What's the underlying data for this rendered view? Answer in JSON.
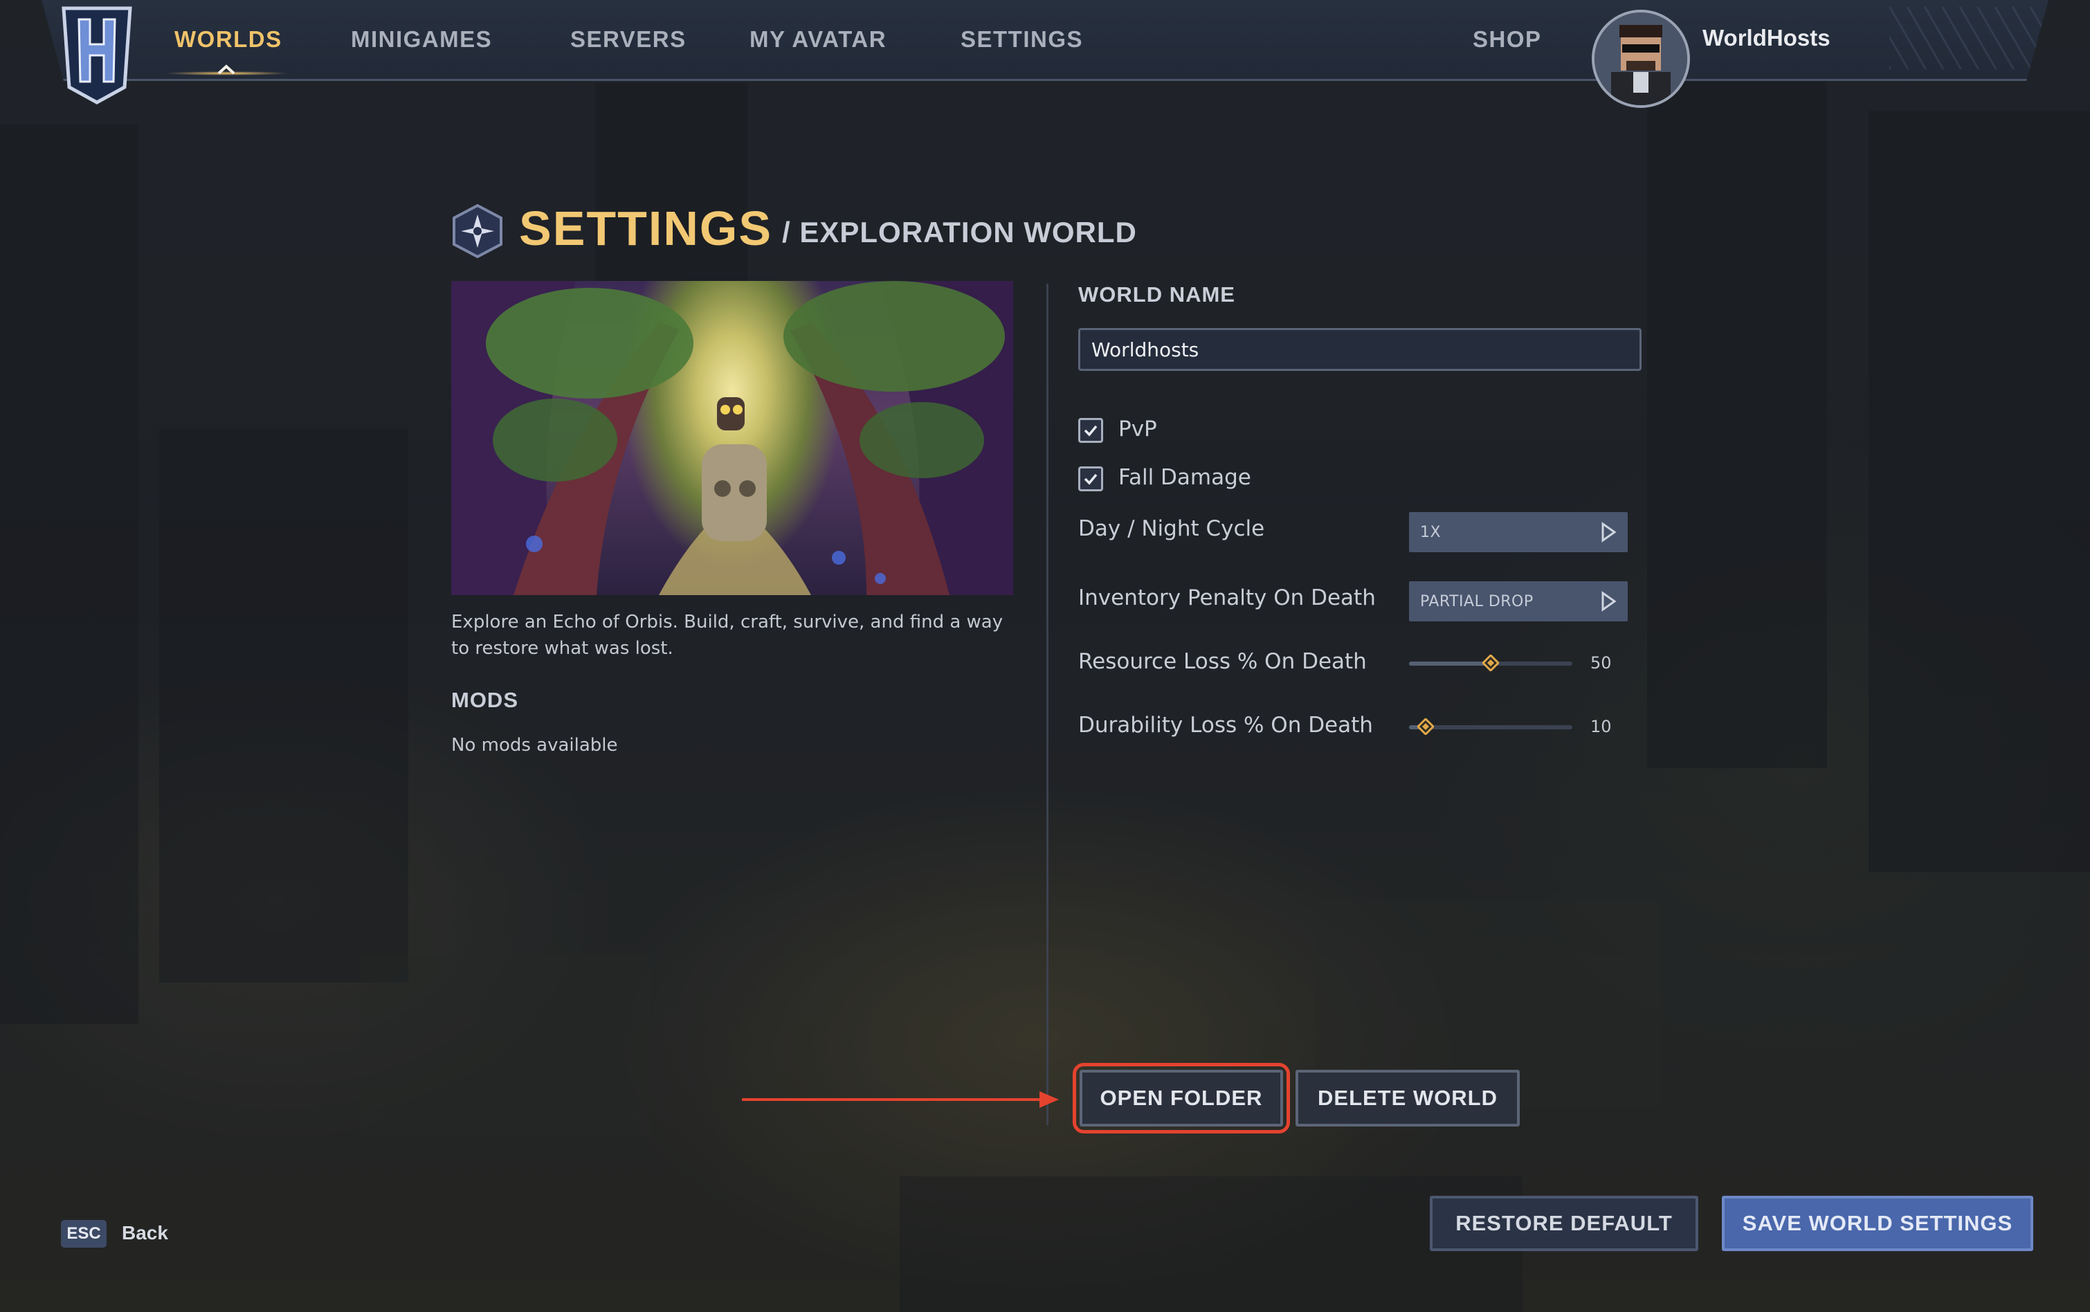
{
  "nav": {
    "items": [
      {
        "label": "WORLDS",
        "active": true
      },
      {
        "label": "MINIGAMES"
      },
      {
        "label": "SERVERS"
      },
      {
        "label": "MY AVATAR"
      },
      {
        "label": "SETTINGS"
      }
    ],
    "shop": "SHOP",
    "username": "WorldHosts",
    "logo_icon": "hytale-h-logo",
    "avatar_icon": "user-avatar"
  },
  "page": {
    "title": "SETTINGS",
    "subtitle": "/ EXPLORATION WORLD",
    "title_icon": "compass-badge-icon"
  },
  "world": {
    "description": "Explore an Echo of Orbis. Build, craft, survive, and find a way to restore what was lost.",
    "mods_heading": "MODS",
    "mods_empty": "No mods available"
  },
  "form": {
    "world_name_label": "WORLD NAME",
    "world_name_value": "Worldhosts",
    "pvp": {
      "label": "PvP",
      "checked": true
    },
    "fall_damage": {
      "label": "Fall Damage",
      "checked": true
    },
    "day_night": {
      "label": "Day / Night Cycle",
      "value": "1X"
    },
    "inventory_penalty": {
      "label": "Inventory Penalty On Death",
      "value": "PARTIAL DROP"
    },
    "resource_loss": {
      "label": "Resource Loss % On Death",
      "value": "50",
      "fraction": 0.5
    },
    "durability_loss": {
      "label": "Durability Loss % On Death",
      "value": "10",
      "fraction": 0.1
    }
  },
  "actions": {
    "open_folder": "OPEN FOLDER",
    "delete_world": "DELETE WORLD",
    "restore_default": "RESTORE DEFAULT",
    "save": "SAVE WORLD SETTINGS"
  },
  "footer": {
    "esc_key": "ESC",
    "back": "Back"
  },
  "colors": {
    "accent_gold": "#f0c36a",
    "primary_blue": "#4a67ab",
    "highlight_red": "#e4432f"
  }
}
